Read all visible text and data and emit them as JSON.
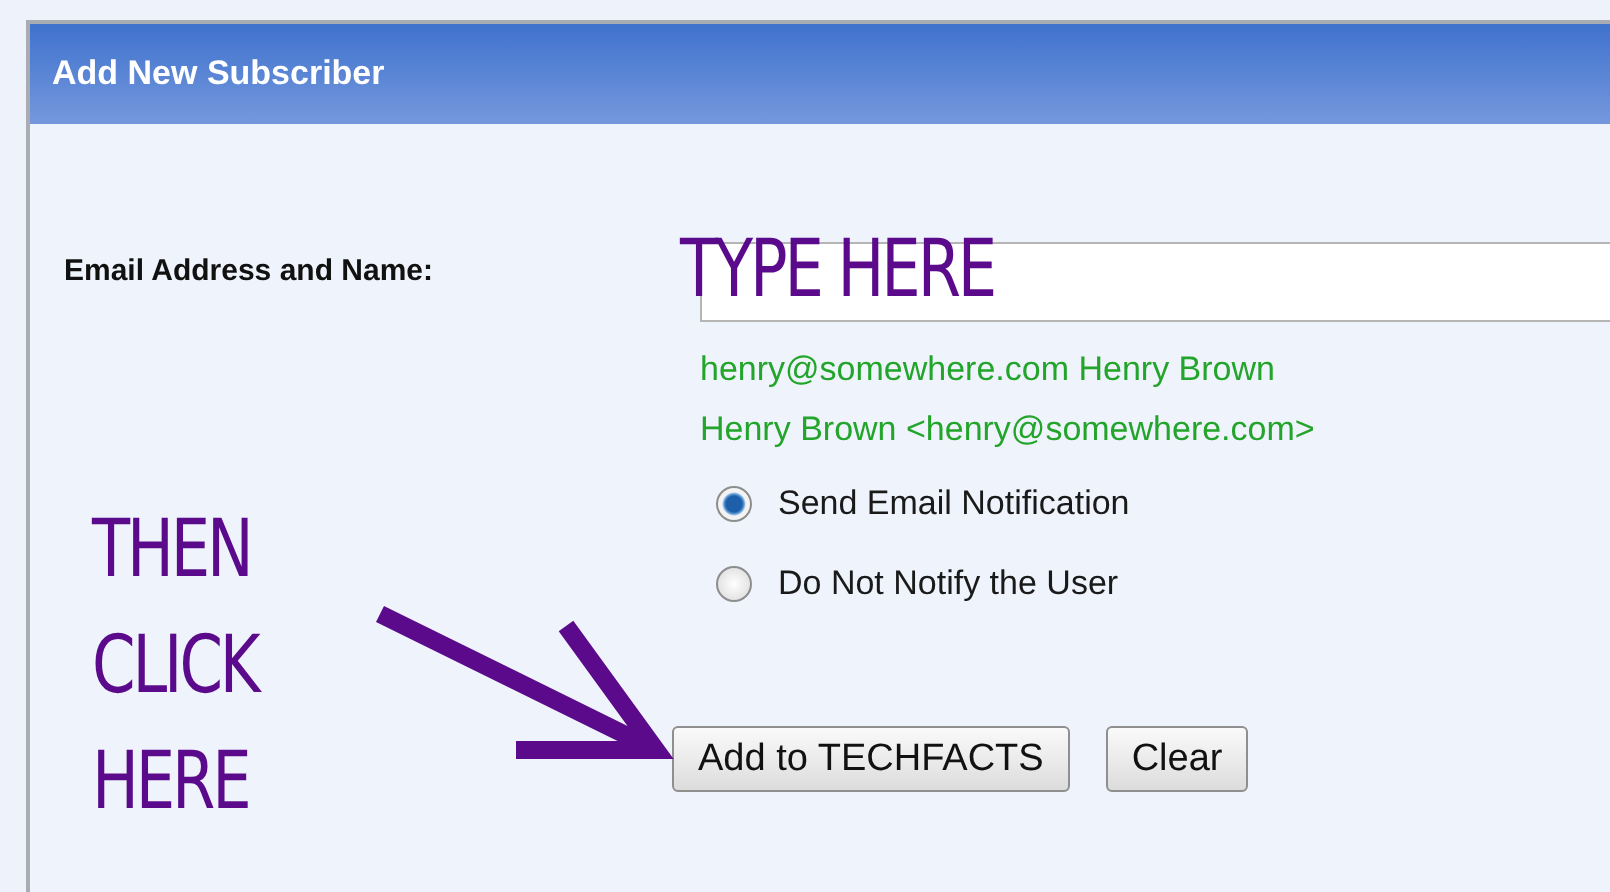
{
  "panel": {
    "title": "Add New Subscriber"
  },
  "form": {
    "label": "Email Address and Name:",
    "examples": [
      "henry@somewhere.com Henry Brown",
      "Henry Brown <henry@somewhere.com>"
    ],
    "options": [
      {
        "label": "Send Email Notification",
        "selected": true
      },
      {
        "label": "Do Not Notify the User",
        "selected": false
      }
    ],
    "buttons": [
      "Add to TECHFACTS",
      "Clear"
    ]
  },
  "annotations": [
    {
      "kind": "field",
      "text": "TYPE HERE"
    },
    {
      "kind": "button",
      "lines": [
        "THEN",
        "CLICK",
        "HERE"
      ]
    }
  ]
}
